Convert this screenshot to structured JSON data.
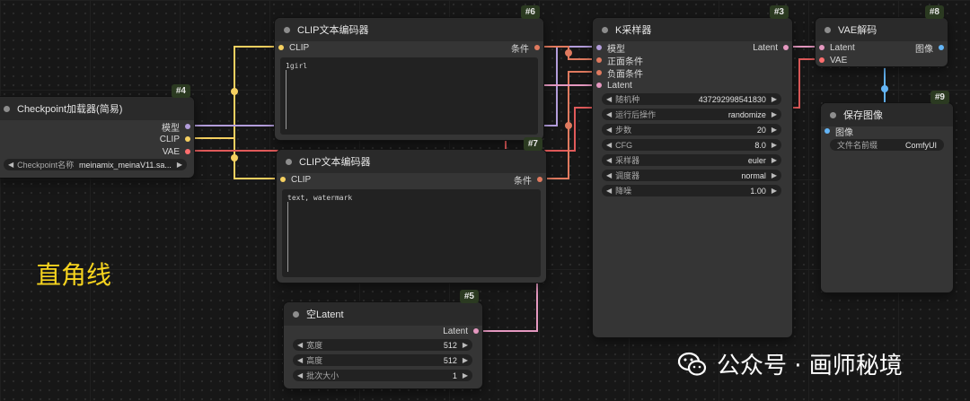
{
  "colors": {
    "model": "#b39ddb",
    "clip": "#f5d060",
    "vae": "#ff6e6e",
    "conditioning": "#e07a5f",
    "latent": "#e598c0",
    "image": "#64b5f6",
    "badge_bg": "#2b3a21",
    "annotation": "#f6d41e"
  },
  "annotation_text": "直角线",
  "watermark": {
    "icon": "wechat-icon",
    "text": "公众号 · 画师秘境"
  },
  "nodes": {
    "checkpoint": {
      "id": "#4",
      "title": "Checkpoint加载器(简易)",
      "outputs": [
        "模型",
        "CLIP",
        "VAE"
      ],
      "widget": {
        "label": "Checkpoint名称",
        "value": "meinamix_meinaV11.sa..."
      }
    },
    "clip_pos": {
      "id": "#6",
      "title": "CLIP文本编码器",
      "input": "CLIP",
      "output": "条件",
      "text": "1girl"
    },
    "clip_neg": {
      "id": "#7",
      "title": "CLIP文本编码器",
      "input": "CLIP",
      "output": "条件",
      "text": "text, watermark"
    },
    "empty_latent": {
      "id": "#5",
      "title": "空Latent",
      "output": "Latent",
      "widgets": [
        {
          "label": "宽度",
          "value": "512"
        },
        {
          "label": "高度",
          "value": "512"
        },
        {
          "label": "批次大小",
          "value": "1"
        }
      ]
    },
    "ksampler": {
      "id": "#3",
      "title": "K采样器",
      "inputs": [
        "模型",
        "正面条件",
        "负面条件",
        "Latent"
      ],
      "output": "Latent",
      "widgets": [
        {
          "label": "随机种",
          "value": "437292998541830"
        },
        {
          "label": "运行后操作",
          "value": "randomize"
        },
        {
          "label": "步数",
          "value": "20"
        },
        {
          "label": "CFG",
          "value": "8.0"
        },
        {
          "label": "采样器",
          "value": "euler"
        },
        {
          "label": "调度器",
          "value": "normal"
        },
        {
          "label": "降噪",
          "value": "1.00"
        }
      ]
    },
    "vae_decode": {
      "id": "#8",
      "title": "VAE解码",
      "inputs": [
        "Latent",
        "VAE"
      ],
      "output": "图像"
    },
    "save_image": {
      "id": "#9",
      "title": "保存图像",
      "input": "图像",
      "widget": {
        "label": "文件名前缀",
        "value": "ComfyUI"
      }
    }
  }
}
